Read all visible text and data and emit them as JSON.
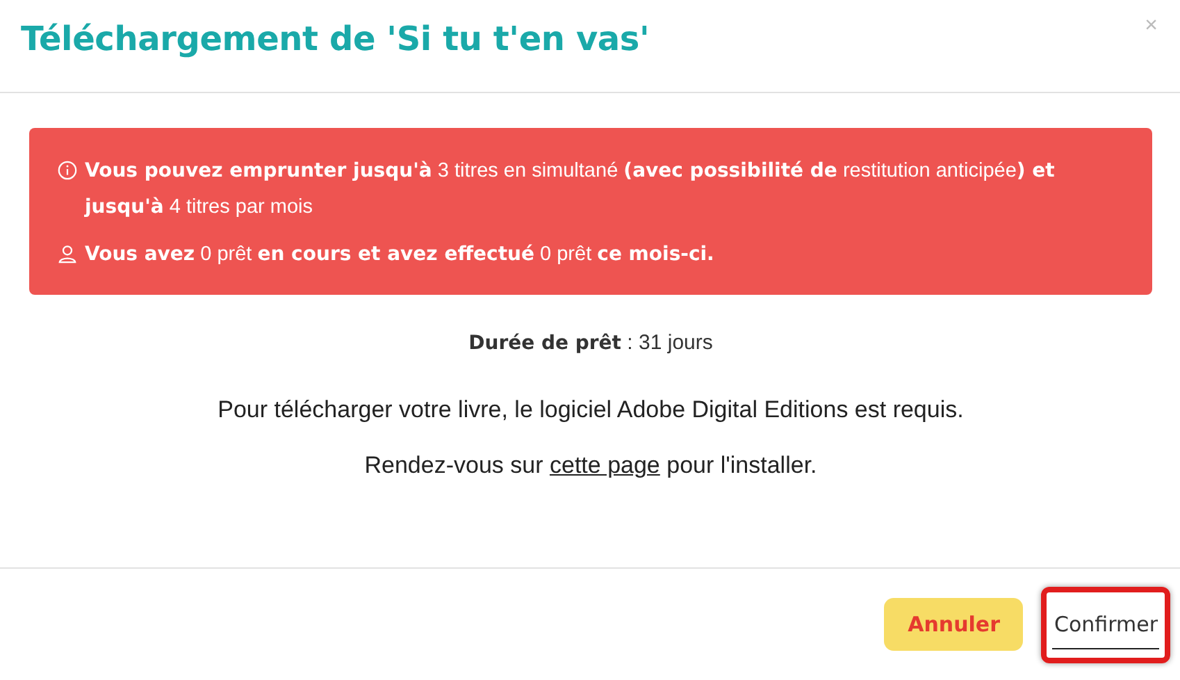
{
  "dialog": {
    "title": "Téléchargement de 'Si tu t'en vas'",
    "close": "×"
  },
  "alert": {
    "lines": [
      {
        "kind": "info",
        "text": "**Vous pouvez emprunter jusqu'à** 3 titres en simultané **(avec possibilité de** restitution anticipée**) et jusqu'à** 4 titres par mois"
      },
      {
        "kind": "user",
        "text": "**Vous avez** 0 prêt **en cours et avez effectué** 0 prêt **ce mois-ci.**"
      }
    ]
  },
  "duration": {
    "label": "Durée de prêt",
    "value": ": 31 jours"
  },
  "info": "Pour télécharger votre livre, le logiciel Adobe Digital Editions est requis.",
  "install": {
    "before": "Rendez-vous sur",
    "link": "cette page",
    "after": "pour l'installer."
  },
  "buttons": [
    {
      "label": "Annuler",
      "kind": "cancel",
      "highlighted": false
    },
    {
      "label": "Confirmer",
      "kind": "confirm",
      "highlighted": true
    }
  ]
}
